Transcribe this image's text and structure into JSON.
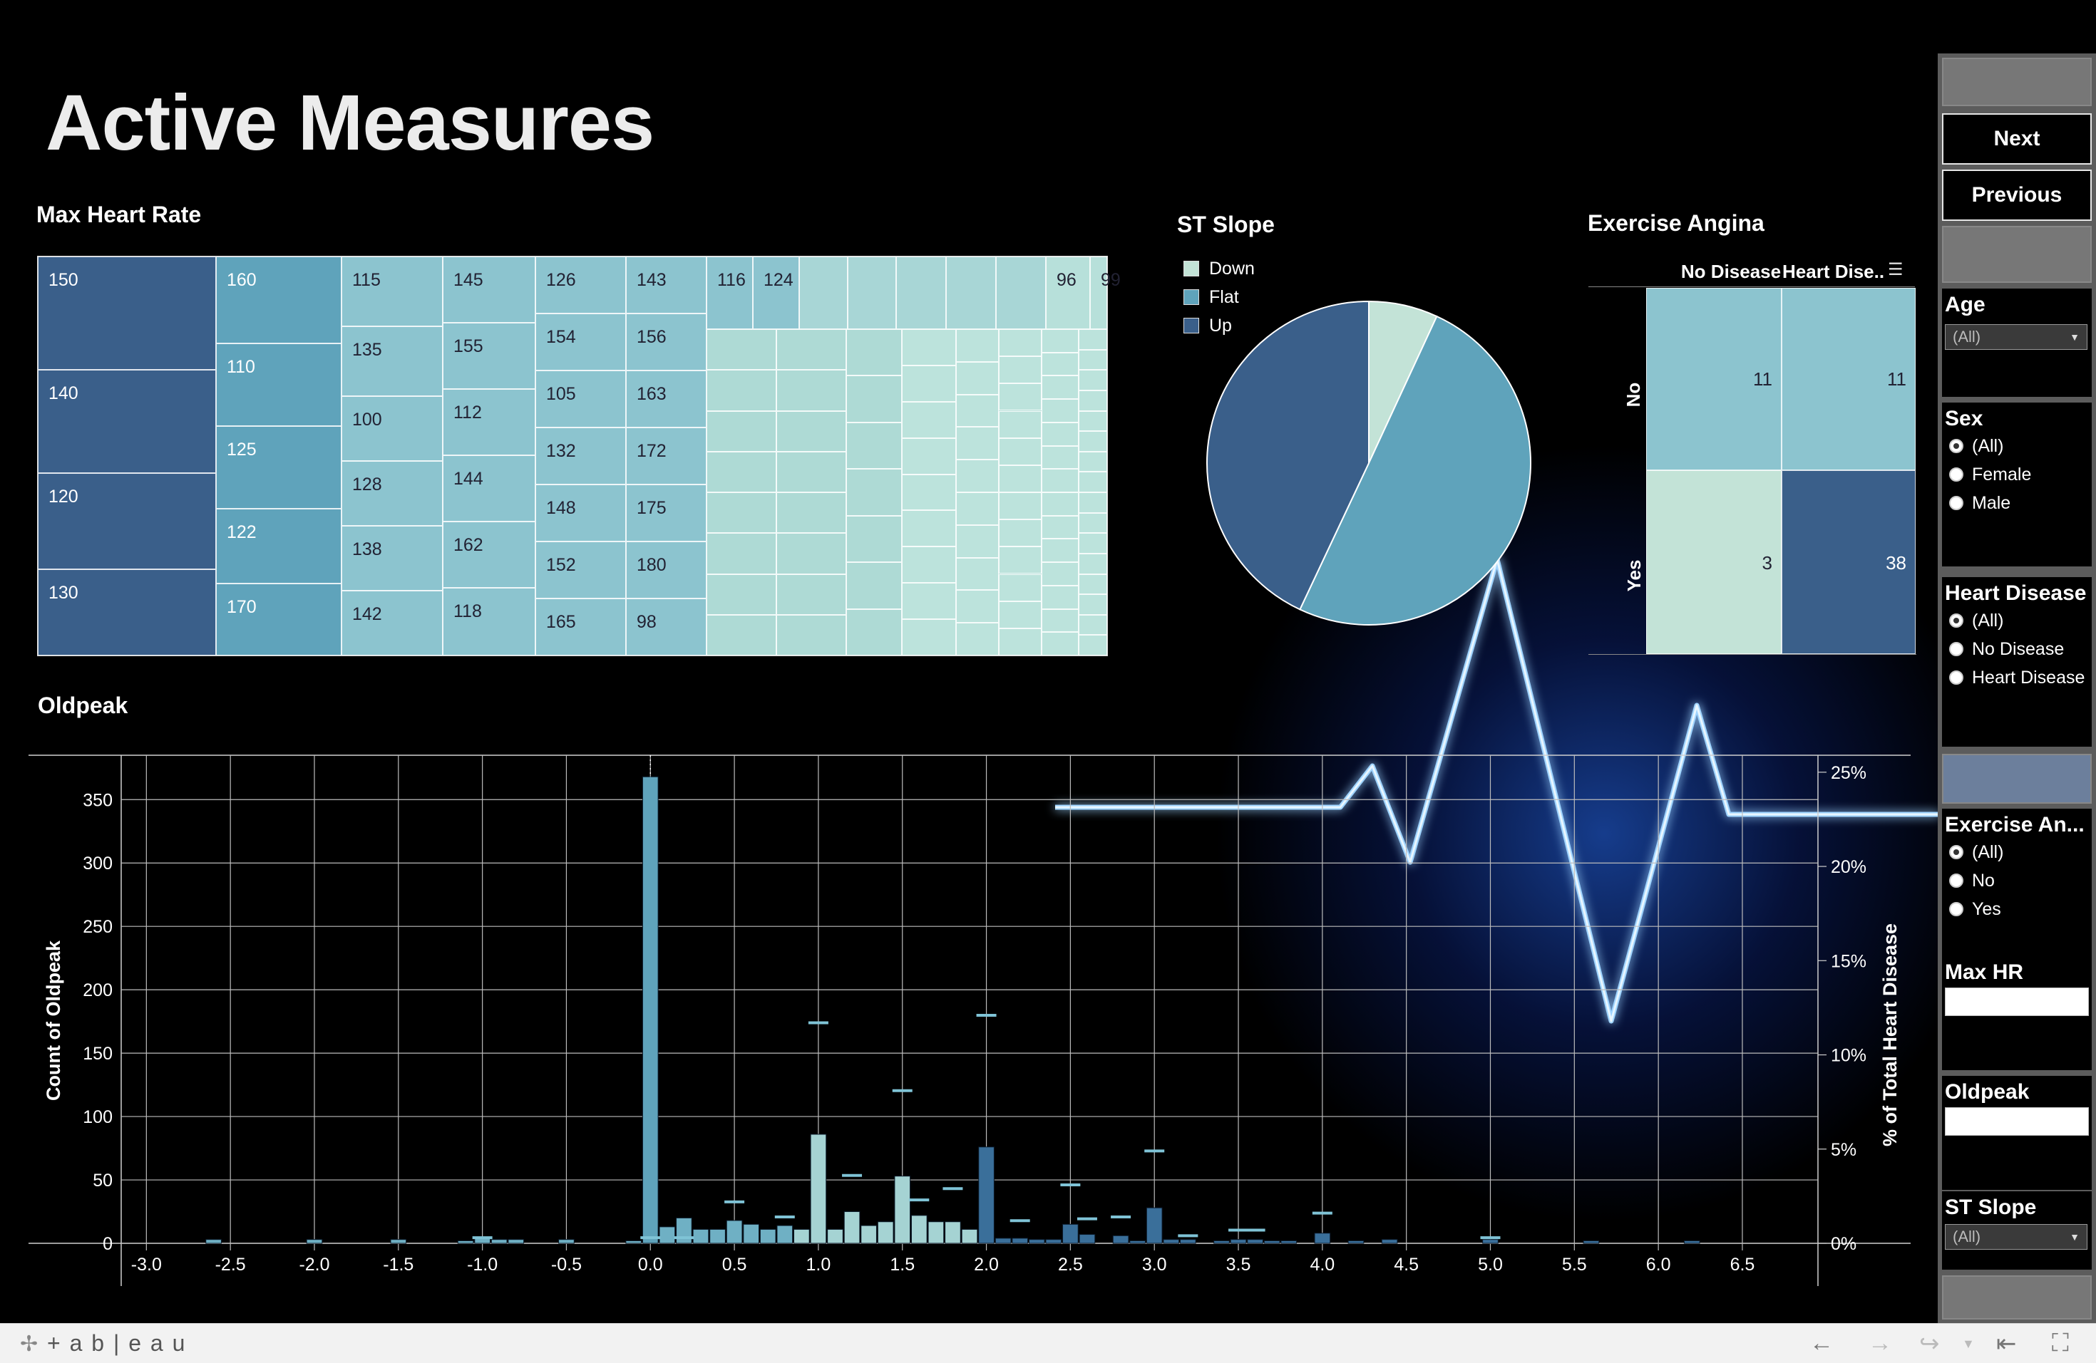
{
  "title": "Active Measures",
  "colors": {
    "background": "#000000",
    "teal_dark": "#3a5f8a",
    "teal_mid": "#5fa3bb",
    "teal_light": "#8cc4cf",
    "teal_pale": "#b2dcd6"
  },
  "max_heart_rate": {
    "title": "Max Heart Rate",
    "cells": [
      {
        "label": "150",
        "count": 33
      },
      {
        "label": "140",
        "count": 30
      },
      {
        "label": "120",
        "count": 28
      },
      {
        "label": "130",
        "count": 25
      },
      {
        "label": "160",
        "count": 22
      },
      {
        "label": "110",
        "count": 21
      },
      {
        "label": "125",
        "count": 21
      },
      {
        "label": "122",
        "count": 19
      },
      {
        "label": "170",
        "count": 18
      },
      {
        "label": "115",
        "count": 15
      },
      {
        "label": "135",
        "count": 15
      },
      {
        "label": "100",
        "count": 14
      },
      {
        "label": "128",
        "count": 14
      },
      {
        "label": "138",
        "count": 14
      },
      {
        "label": "142",
        "count": 14
      },
      {
        "label": "145",
        "count": 12
      },
      {
        "label": "155",
        "count": 12
      },
      {
        "label": "112",
        "count": 12
      },
      {
        "label": "144",
        "count": 12
      },
      {
        "label": "162",
        "count": 12
      },
      {
        "label": "118",
        "count": 12
      },
      {
        "label": "126",
        "count": 11
      },
      {
        "label": "154",
        "count": 11
      },
      {
        "label": "105",
        "count": 11
      },
      {
        "label": "132",
        "count": 11
      },
      {
        "label": "148",
        "count": 11
      },
      {
        "label": "152",
        "count": 11
      },
      {
        "label": "165",
        "count": 11
      },
      {
        "label": "143",
        "count": 10
      },
      {
        "label": "156",
        "count": 10
      },
      {
        "label": "163",
        "count": 10
      },
      {
        "label": "172",
        "count": 10
      },
      {
        "label": "175",
        "count": 10
      },
      {
        "label": "180",
        "count": 10
      },
      {
        "label": "98",
        "count": 10
      },
      {
        "label": "116",
        "count": 9
      },
      {
        "label": "124",
        "count": 9
      },
      {
        "label": "96",
        "count": 9
      },
      {
        "label": "99",
        "count": 9
      }
    ]
  },
  "st_slope": {
    "title": "ST Slope",
    "legend": [
      {
        "label": "Down",
        "color": "#c3e3d7"
      },
      {
        "label": "Flat",
        "color": "#5fa3bb"
      },
      {
        "label": "Up",
        "color": "#3a5f8a"
      }
    ]
  },
  "exercise_angina": {
    "title": "Exercise Angina",
    "columns": [
      "No Disease",
      "Heart Dise.."
    ],
    "rows": [
      "No",
      "Yes"
    ],
    "values": [
      [
        11,
        11
      ],
      [
        3,
        38
      ]
    ],
    "colors": [
      [
        "#8cc4cf",
        "#8cc4cf"
      ],
      [
        "#c3e3d7",
        "#3a5f8a"
      ]
    ]
  },
  "oldpeak": {
    "title": "Oldpeak",
    "y_left_label": "Count of Oldpeak",
    "y_left_ticks": [
      "0",
      "50",
      "100",
      "150",
      "200",
      "250",
      "300",
      "350"
    ],
    "y_right_label": "% of Total Heart Disease",
    "y_right_ticks": [
      "0%",
      "5%",
      "10%",
      "15%",
      "20%",
      "25%"
    ],
    "x_ticks": [
      "-3.0",
      "-2.5",
      "-2.0",
      "-1.5",
      "-1.0",
      "-0.5",
      "0.0",
      "0.5",
      "1.0",
      "1.5",
      "2.0",
      "2.5",
      "3.0",
      "3.5",
      "4.0",
      "4.5",
      "5.0",
      "5.5",
      "6.0",
      "6.5"
    ]
  },
  "chart_data": [
    {
      "type": "heatmap",
      "title": "Max Heart Rate",
      "note": "treemap of Max HR values sized by count",
      "categories": [
        "150",
        "140",
        "120",
        "130",
        "160",
        "110",
        "125",
        "122",
        "170",
        "115",
        "135",
        "100",
        "128",
        "138",
        "142",
        "145",
        "155",
        "112",
        "144",
        "162",
        "118",
        "126",
        "154",
        "105",
        "132",
        "148",
        "152",
        "165",
        "143",
        "156",
        "163",
        "172",
        "175",
        "180",
        "98",
        "116",
        "124",
        "96",
        "99"
      ]
    },
    {
      "type": "pie",
      "title": "ST Slope",
      "categories": [
        "Down",
        "Flat",
        "Up"
      ],
      "values": [
        6.9,
        50.1,
        43.0
      ]
    },
    {
      "type": "table",
      "title": "Exercise Angina",
      "columns": [
        "No Disease",
        "Heart Dise.."
      ],
      "rows": [
        "No",
        "Yes"
      ],
      "values": [
        [
          11,
          11
        ],
        [
          3,
          38
        ]
      ]
    },
    {
      "type": "bar",
      "title": "Oldpeak",
      "xlabel": "",
      "ylabel": "Count of Oldpeak",
      "y2label": "% of Total Heart Disease",
      "xlim": [
        -3.0,
        6.7
      ],
      "ylim": [
        0,
        380
      ],
      "y2lim": [
        0,
        25.5
      ],
      "series": [
        {
          "name": "Count of Oldpeak",
          "x": [
            -2.6,
            -2.0,
            -1.5,
            -1.1,
            -1.0,
            -0.9,
            -0.8,
            -0.5,
            -0.1,
            0.0,
            0.1,
            0.2,
            0.3,
            0.4,
            0.5,
            0.6,
            0.7,
            0.8,
            0.9,
            1.0,
            1.1,
            1.2,
            1.3,
            1.4,
            1.5,
            1.6,
            1.7,
            1.8,
            1.9,
            2.0,
            2.1,
            2.2,
            2.3,
            2.4,
            2.5,
            2.6,
            2.8,
            2.9,
            3.0,
            3.1,
            3.2,
            3.4,
            3.5,
            3.6,
            3.7,
            3.8,
            4.0,
            4.2,
            4.4,
            5.0,
            5.6,
            6.2
          ],
          "values": [
            3,
            3,
            3,
            2,
            4,
            3,
            3,
            3,
            2,
            368,
            13,
            20,
            11,
            11,
            18,
            15,
            11,
            14,
            11,
            86,
            11,
            25,
            14,
            17,
            53,
            22,
            17,
            17,
            11,
            76,
            4,
            4,
            3,
            3,
            15,
            7,
            6,
            2,
            28,
            3,
            3,
            2,
            3,
            3,
            2,
            2,
            8,
            2,
            3,
            3,
            2,
            2
          ]
        },
        {
          "name": "% of Total Heart Disease",
          "x": [
            -1.0,
            0.0,
            0.2,
            0.5,
            0.8,
            1.0,
            1.2,
            1.5,
            1.6,
            1.8,
            2.0,
            2.2,
            2.5,
            2.6,
            2.8,
            3.0,
            3.2,
            3.5,
            3.6,
            4.0,
            5.0
          ],
          "values": [
            0.3,
            0.3,
            0.3,
            2.2,
            1.4,
            11.7,
            3.6,
            8.1,
            2.3,
            2.9,
            12.1,
            1.2,
            3.1,
            1.3,
            1.4,
            4.9,
            0.4,
            0.7,
            0.7,
            1.6,
            0.3
          ]
        }
      ]
    }
  ],
  "sidebar": {
    "next_label": "Next",
    "previous_label": "Previous",
    "age": {
      "title": "Age",
      "value": "(All)"
    },
    "sex": {
      "title": "Sex",
      "options": [
        "(All)",
        "Female",
        "Male"
      ],
      "selected": 0
    },
    "heart_disease": {
      "title": "Heart Disease",
      "options": [
        "(All)",
        "No Disease",
        "Heart Disease"
      ],
      "selected": 0
    },
    "exercise_angina": {
      "title": "Exercise An...",
      "options": [
        "(All)",
        "No",
        "Yes"
      ],
      "selected": 0
    },
    "max_hr": {
      "title": "Max HR"
    },
    "oldpeak": {
      "title": "Oldpeak"
    },
    "st_slope": {
      "title": "ST Slope",
      "value": "(All)"
    }
  },
  "footer": {
    "brand": "+ a b | e a u",
    "icons": [
      "undo-icon",
      "redo-icon",
      "revert-icon",
      "reset-icon",
      "fullscreen-icon"
    ]
  }
}
